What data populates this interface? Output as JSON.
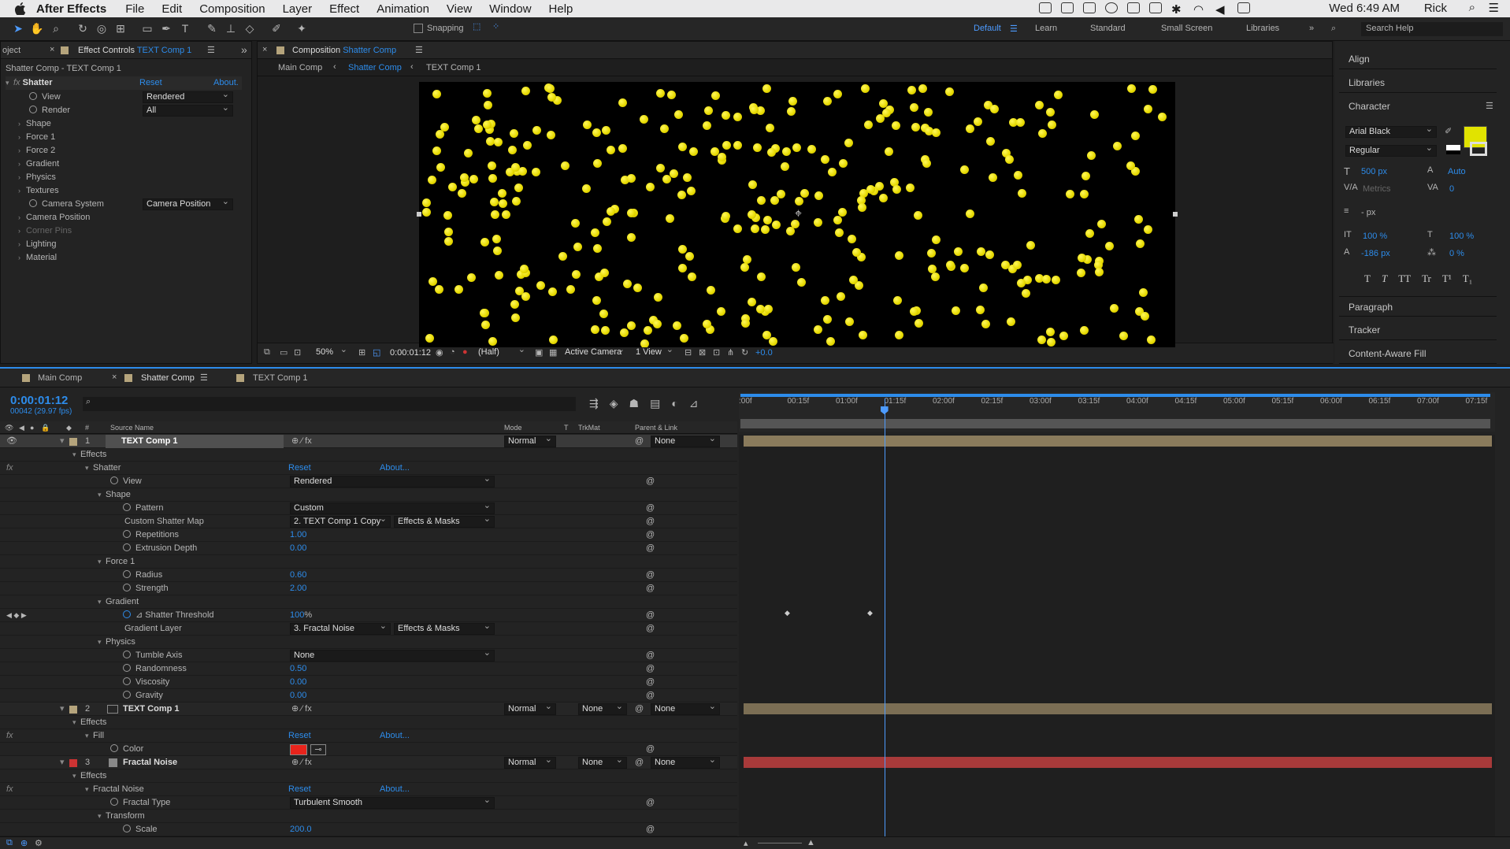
{
  "menubar": {
    "app_name": "After Effects",
    "menus": [
      "File",
      "Edit",
      "Composition",
      "Layer",
      "Effect",
      "Animation",
      "View",
      "Window",
      "Help"
    ],
    "clock": "Wed 6:49 AM",
    "user": "Rick"
  },
  "toolbar": {
    "snapping_label": "Snapping",
    "workspaces": [
      "Default",
      "Learn",
      "Standard",
      "Small Screen",
      "Libraries"
    ],
    "search_placeholder": "Search Help"
  },
  "effect_controls": {
    "tab_left": "oject",
    "tab_title": "Effect Controls",
    "tab_layer": "TEXT Comp 1",
    "subtitle": "Shatter Comp - TEXT Comp 1",
    "effect_name": "Shatter",
    "reset": "Reset",
    "about": "About.",
    "view_label": "View",
    "view_value": "Rendered",
    "render_label": "Render",
    "render_value": "All",
    "groups": [
      "Shape",
      "Force 1",
      "Force 2",
      "Gradient",
      "Physics",
      "Textures"
    ],
    "camera_system_label": "Camera System",
    "camera_system_value": "Camera Position",
    "groups2": [
      "Camera Position",
      "Corner Pins",
      "Lighting",
      "Material"
    ]
  },
  "composition": {
    "tab_title": "Composition",
    "tab_name": "Shatter Comp",
    "crumbs": [
      "Main Comp",
      "Shatter Comp",
      "TEXT Comp 1"
    ],
    "zoom": "50%",
    "timecode": "0:00:01:12",
    "resolution": "(Half)",
    "camera": "Active Camera",
    "views": "1 View",
    "exposure": "+0.0"
  },
  "right_panel": {
    "align": "Align",
    "libraries": "Libraries",
    "character": "Character",
    "font": "Arial Black",
    "style": "Regular",
    "font_size": "500 px",
    "leading": "Auto",
    "kerning": "Metrics",
    "tracking": "0",
    "stroke": "- px",
    "vscale": "100 %",
    "hscale": "100 %",
    "baseline": "-186 px",
    "tsume": "0 %",
    "fill_color": "#e1e300",
    "paragraph": "Paragraph",
    "tracker": "Tracker",
    "content_aware": "Content-Aware Fill"
  },
  "timeline": {
    "tabs": [
      "Main Comp",
      "Shatter Comp",
      "TEXT Comp 1"
    ],
    "timecode": "0:00:01:12",
    "frames": "00042 (29.97 fps)",
    "columns": {
      "source": "Source Name",
      "mode": "Mode",
      "t": "T",
      "trkmat": "TrkMat",
      "parent": "Parent & Link"
    },
    "ruler": [
      ":00f",
      "00:15f",
      "01:00f",
      "01:15f",
      "02:00f",
      "02:15f",
      "03:00f",
      "03:15f",
      "04:00f",
      "04:15f",
      "05:00f",
      "05:15f",
      "06:00f",
      "06:15f",
      "07:00f",
      "07:15f"
    ],
    "layer1": {
      "num": "1",
      "name": "TEXT Comp 1",
      "mode": "Normal",
      "parent": "None"
    },
    "effects": "Effects",
    "shatter": "Shatter",
    "reset": "Reset",
    "about": "About...",
    "view_label": "View",
    "view_value": "Rendered",
    "shape": "Shape",
    "pattern_label": "Pattern",
    "pattern_value": "Custom",
    "map_label": "Custom Shatter Map",
    "map_value": "2. TEXT Comp 1 Copy",
    "effects_masks": "Effects & Masks",
    "rep_label": "Repetitions",
    "rep_value": "1.00",
    "ext_label": "Extrusion Depth",
    "ext_value": "0.00",
    "force1": "Force 1",
    "radius_label": "Radius",
    "radius_value": "0.60",
    "strength_label": "Strength",
    "strength_value": "2.00",
    "gradient": "Gradient",
    "thresh_label": "Shatter Threshold",
    "thresh_value": "100",
    "percent": "%",
    "gl_label": "Gradient Layer",
    "gl_value": "3. Fractal Noise",
    "physics": "Physics",
    "tumble_label": "Tumble Axis",
    "tumble_value": "None",
    "random_label": "Randomness",
    "random_value": "0.50",
    "visc_label": "Viscosity",
    "visc_value": "0.00",
    "grav_label": "Gravity",
    "grav_value": "0.00",
    "layer2": {
      "num": "2",
      "name": "TEXT Comp 1",
      "mode": "Normal",
      "trk": "None",
      "parent": "None"
    },
    "fill": "Fill",
    "color_label": "Color",
    "color_value": "#e8241c",
    "layer3": {
      "num": "3",
      "name": "Fractal Noise",
      "mode": "Normal",
      "trk": "None",
      "parent": "None"
    },
    "fractal_noise": "Fractal Noise",
    "ftype_label": "Fractal Type",
    "ftype_value": "Turbulent Smooth",
    "transform": "Transform",
    "scale_label": "Scale",
    "scale_value": "200.0",
    "playhead_fraction": 0.188
  }
}
